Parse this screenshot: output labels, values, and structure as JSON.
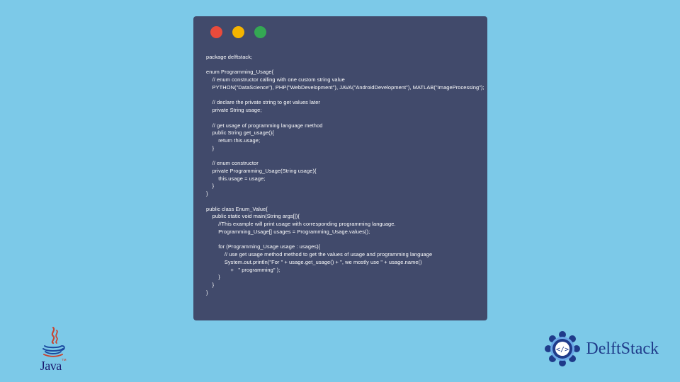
{
  "window": {
    "traffic_lights": [
      "red",
      "yellow",
      "green"
    ]
  },
  "code": {
    "lines": [
      "package delftstack;",
      "",
      "enum Programming_Usage{",
      "    // enum constructor calling with one custom string value",
      "    PYTHON(\"DataScience\"), PHP(\"WebDevelopment\"), JAVA(\"AndroidDevelopment\"), MATLAB(\"ImageProcessing\");",
      "",
      "    // declare the private string to get values later",
      "    private String usage;",
      "",
      "    // get usage of programming language method",
      "    public String get_usage(){",
      "        return this.usage;",
      "    }",
      "",
      "    // enum constructor",
      "    private Programming_Usage(String usage){",
      "        this.usage = usage;",
      "    }",
      "}",
      "",
      "public class Enum_Value{",
      "    public static void main(String args[]){",
      "        //This example will print usage with corresponding programming language.",
      "        Programming_Usage[] usages = Programming_Usage.values();",
      "",
      "        for (Programming_Usage usage : usages){",
      "            // use get usage method method to get the values of usage and programming language",
      "            System.out.println(\"For \" + usage.get_usage() + \", we mostly use \" + usage.name()",
      "                +   \" programming\" );",
      "        }",
      "    }",
      "}"
    ]
  },
  "logos": {
    "java": {
      "word": "Java",
      "tm": "™"
    },
    "delftstack": {
      "word": "DelftStack"
    }
  }
}
